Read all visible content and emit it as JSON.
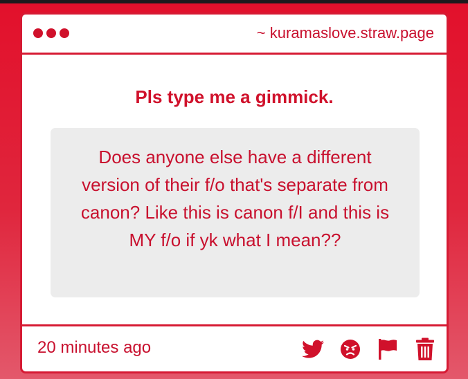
{
  "window": {
    "url": "~ kuramaslove.straw.page",
    "dot_color": "#d0112b"
  },
  "post": {
    "heading": "Pls type me a gimmick.",
    "message": "Does anyone else have a different version of their f/o that's separate from canon? Like this is canon f/I and this is MY f/o if yk what I mean??",
    "timestamp": "20 minutes ago"
  },
  "actions": {
    "icons": [
      "twitter-icon",
      "angry-face-icon",
      "flag-icon",
      "trash-icon"
    ]
  },
  "colors": {
    "accent": "#d0112b",
    "text": "#c8102e",
    "message_bg": "#ececec",
    "page_bg": "#e2102b"
  }
}
